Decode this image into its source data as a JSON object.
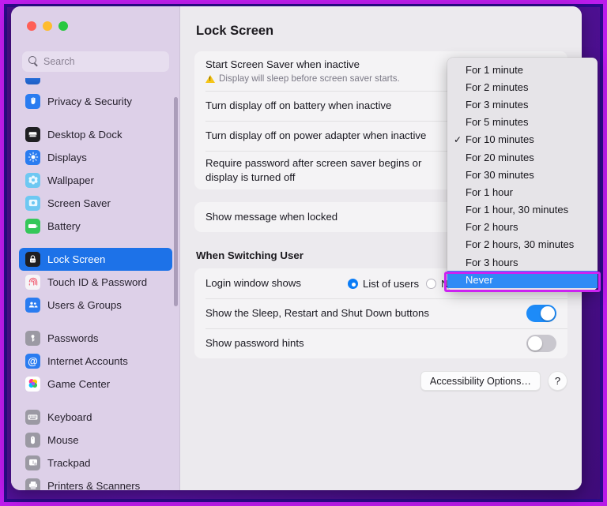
{
  "window": {
    "traffic_lights": [
      "close",
      "minimize",
      "zoom"
    ],
    "colors": {
      "accent_blue": "#1d72e8",
      "toggle_on": "#1d8bf8",
      "highlight_magenta": "#cc22f2",
      "warning_yellow": "#f5c518"
    }
  },
  "search": {
    "placeholder": "Search",
    "value": "",
    "icon": "search-icon"
  },
  "sidebar": {
    "clipped_top_item": {
      "label": ""
    },
    "groups": [
      {
        "items": [
          {
            "label": "Privacy & Security",
            "icon": "hand-icon",
            "icon_bg": "#2a7cf0"
          }
        ]
      },
      {
        "items": [
          {
            "label": "Desktop & Dock",
            "icon": "dock-icon",
            "icon_bg": "#1f1f22"
          },
          {
            "label": "Displays",
            "icon": "brightness-icon",
            "icon_bg": "#2a7cf0"
          },
          {
            "label": "Wallpaper",
            "icon": "flower-icon",
            "icon_bg": "#5ec3f0"
          },
          {
            "label": "Screen Saver",
            "icon": "screensaver-icon",
            "icon_bg": "#5ec3f0"
          },
          {
            "label": "Battery",
            "icon": "battery-icon",
            "icon_bg": "#34c759"
          }
        ]
      },
      {
        "items": [
          {
            "label": "Lock Screen",
            "icon": "lock-icon",
            "icon_bg": "#1f1f22",
            "selected": true
          },
          {
            "label": "Touch ID & Password",
            "icon": "fingerprint-icon",
            "icon_bg": "#f25f72"
          },
          {
            "label": "Users & Groups",
            "icon": "users-icon",
            "icon_bg": "#2a7cf0"
          }
        ]
      },
      {
        "items": [
          {
            "label": "Passwords",
            "icon": "key-icon",
            "icon_bg": "#9b99a3"
          },
          {
            "label": "Internet Accounts",
            "icon": "at-icon",
            "icon_bg": "#2a7cf0"
          },
          {
            "label": "Game Center",
            "icon": "gamecenter-icon",
            "icon_bg": "#ffffff"
          }
        ]
      },
      {
        "items": [
          {
            "label": "Keyboard",
            "icon": "keyboard-icon",
            "icon_bg": "#9b99a3"
          },
          {
            "label": "Mouse",
            "icon": "mouse-icon",
            "icon_bg": "#9b99a3"
          },
          {
            "label": "Trackpad",
            "icon": "trackpad-icon",
            "icon_bg": "#9b99a3"
          },
          {
            "label": "Printers & Scanners",
            "icon": "printer-icon",
            "icon_bg": "#9b99a3"
          }
        ]
      }
    ]
  },
  "main": {
    "title": "Lock Screen",
    "card1": {
      "row1": {
        "label": "Start Screen Saver when inactive",
        "warning": "Display will sleep before screen saver starts.",
        "warning_icon": "warning-triangle-icon"
      },
      "row2": {
        "label": "Turn display off on battery when inactive"
      },
      "row3": {
        "label": "Turn display off on power adapter when inactive"
      },
      "row4": {
        "label": "Require password after screen saver begins or display is turned off"
      }
    },
    "card2": {
      "row1": {
        "label": "Show message when locked"
      }
    },
    "section2_title": "When Switching User",
    "card3": {
      "row1": {
        "label": "Login window shows",
        "options": [
          {
            "label": "List of users",
            "selected": true
          },
          {
            "label": "Name and password",
            "selected": false
          }
        ]
      },
      "row2": {
        "label": "Show the Sleep, Restart and Shut Down buttons",
        "toggle": "on"
      },
      "row3": {
        "label": "Show password hints",
        "toggle": "off"
      }
    },
    "footer": {
      "accessibility_button": "Accessibility Options…",
      "help_button": "?"
    }
  },
  "dropdown": {
    "selected": "For 10 minutes",
    "highlighted": "Never",
    "items": [
      {
        "label": "For 1 minute"
      },
      {
        "label": "For 2 minutes"
      },
      {
        "label": "For 3 minutes"
      },
      {
        "label": "For 5 minutes"
      },
      {
        "label": "For 10 minutes",
        "checked": true
      },
      {
        "label": "For 20 minutes"
      },
      {
        "label": "For 30 minutes"
      },
      {
        "label": "For 1 hour"
      },
      {
        "label": "For 1 hour, 30 minutes"
      },
      {
        "label": "For 2 hours"
      },
      {
        "label": "For 2 hours, 30 minutes"
      },
      {
        "label": "For 3 hours"
      },
      {
        "label": "Never",
        "highlighted": true
      }
    ],
    "check_glyph": "✓"
  }
}
